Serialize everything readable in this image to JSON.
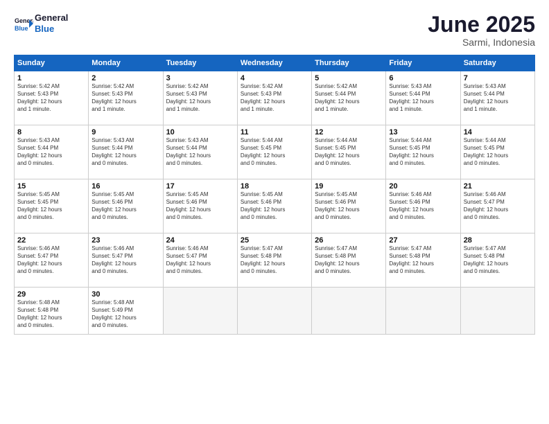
{
  "logo": {
    "line1": "General",
    "line2": "Blue"
  },
  "title": "June 2025",
  "location": "Sarmi, Indonesia",
  "weekdays": [
    "Sunday",
    "Monday",
    "Tuesday",
    "Wednesday",
    "Thursday",
    "Friday",
    "Saturday"
  ],
  "weeks": [
    [
      {
        "day": "1",
        "info": "Sunrise: 5:42 AM\nSunset: 5:43 PM\nDaylight: 12 hours\nand 1 minute."
      },
      {
        "day": "2",
        "info": "Sunrise: 5:42 AM\nSunset: 5:43 PM\nDaylight: 12 hours\nand 1 minute."
      },
      {
        "day": "3",
        "info": "Sunrise: 5:42 AM\nSunset: 5:43 PM\nDaylight: 12 hours\nand 1 minute."
      },
      {
        "day": "4",
        "info": "Sunrise: 5:42 AM\nSunset: 5:43 PM\nDaylight: 12 hours\nand 1 minute."
      },
      {
        "day": "5",
        "info": "Sunrise: 5:42 AM\nSunset: 5:44 PM\nDaylight: 12 hours\nand 1 minute."
      },
      {
        "day": "6",
        "info": "Sunrise: 5:43 AM\nSunset: 5:44 PM\nDaylight: 12 hours\nand 1 minute."
      },
      {
        "day": "7",
        "info": "Sunrise: 5:43 AM\nSunset: 5:44 PM\nDaylight: 12 hours\nand 1 minute."
      }
    ],
    [
      {
        "day": "8",
        "info": "Sunrise: 5:43 AM\nSunset: 5:44 PM\nDaylight: 12 hours\nand 0 minutes."
      },
      {
        "day": "9",
        "info": "Sunrise: 5:43 AM\nSunset: 5:44 PM\nDaylight: 12 hours\nand 0 minutes."
      },
      {
        "day": "10",
        "info": "Sunrise: 5:43 AM\nSunset: 5:44 PM\nDaylight: 12 hours\nand 0 minutes."
      },
      {
        "day": "11",
        "info": "Sunrise: 5:44 AM\nSunset: 5:45 PM\nDaylight: 12 hours\nand 0 minutes."
      },
      {
        "day": "12",
        "info": "Sunrise: 5:44 AM\nSunset: 5:45 PM\nDaylight: 12 hours\nand 0 minutes."
      },
      {
        "day": "13",
        "info": "Sunrise: 5:44 AM\nSunset: 5:45 PM\nDaylight: 12 hours\nand 0 minutes."
      },
      {
        "day": "14",
        "info": "Sunrise: 5:44 AM\nSunset: 5:45 PM\nDaylight: 12 hours\nand 0 minutes."
      }
    ],
    [
      {
        "day": "15",
        "info": "Sunrise: 5:45 AM\nSunset: 5:45 PM\nDaylight: 12 hours\nand 0 minutes."
      },
      {
        "day": "16",
        "info": "Sunrise: 5:45 AM\nSunset: 5:46 PM\nDaylight: 12 hours\nand 0 minutes."
      },
      {
        "day": "17",
        "info": "Sunrise: 5:45 AM\nSunset: 5:46 PM\nDaylight: 12 hours\nand 0 minutes."
      },
      {
        "day": "18",
        "info": "Sunrise: 5:45 AM\nSunset: 5:46 PM\nDaylight: 12 hours\nand 0 minutes."
      },
      {
        "day": "19",
        "info": "Sunrise: 5:45 AM\nSunset: 5:46 PM\nDaylight: 12 hours\nand 0 minutes."
      },
      {
        "day": "20",
        "info": "Sunrise: 5:46 AM\nSunset: 5:46 PM\nDaylight: 12 hours\nand 0 minutes."
      },
      {
        "day": "21",
        "info": "Sunrise: 5:46 AM\nSunset: 5:47 PM\nDaylight: 12 hours\nand 0 minutes."
      }
    ],
    [
      {
        "day": "22",
        "info": "Sunrise: 5:46 AM\nSunset: 5:47 PM\nDaylight: 12 hours\nand 0 minutes."
      },
      {
        "day": "23",
        "info": "Sunrise: 5:46 AM\nSunset: 5:47 PM\nDaylight: 12 hours\nand 0 minutes."
      },
      {
        "day": "24",
        "info": "Sunrise: 5:46 AM\nSunset: 5:47 PM\nDaylight: 12 hours\nand 0 minutes."
      },
      {
        "day": "25",
        "info": "Sunrise: 5:47 AM\nSunset: 5:48 PM\nDaylight: 12 hours\nand 0 minutes."
      },
      {
        "day": "26",
        "info": "Sunrise: 5:47 AM\nSunset: 5:48 PM\nDaylight: 12 hours\nand 0 minutes."
      },
      {
        "day": "27",
        "info": "Sunrise: 5:47 AM\nSunset: 5:48 PM\nDaylight: 12 hours\nand 0 minutes."
      },
      {
        "day": "28",
        "info": "Sunrise: 5:47 AM\nSunset: 5:48 PM\nDaylight: 12 hours\nand 0 minutes."
      }
    ],
    [
      {
        "day": "29",
        "info": "Sunrise: 5:48 AM\nSunset: 5:48 PM\nDaylight: 12 hours\nand 0 minutes."
      },
      {
        "day": "30",
        "info": "Sunrise: 5:48 AM\nSunset: 5:49 PM\nDaylight: 12 hours\nand 0 minutes."
      },
      {
        "day": "",
        "info": ""
      },
      {
        "day": "",
        "info": ""
      },
      {
        "day": "",
        "info": ""
      },
      {
        "day": "",
        "info": ""
      },
      {
        "day": "",
        "info": ""
      }
    ]
  ]
}
